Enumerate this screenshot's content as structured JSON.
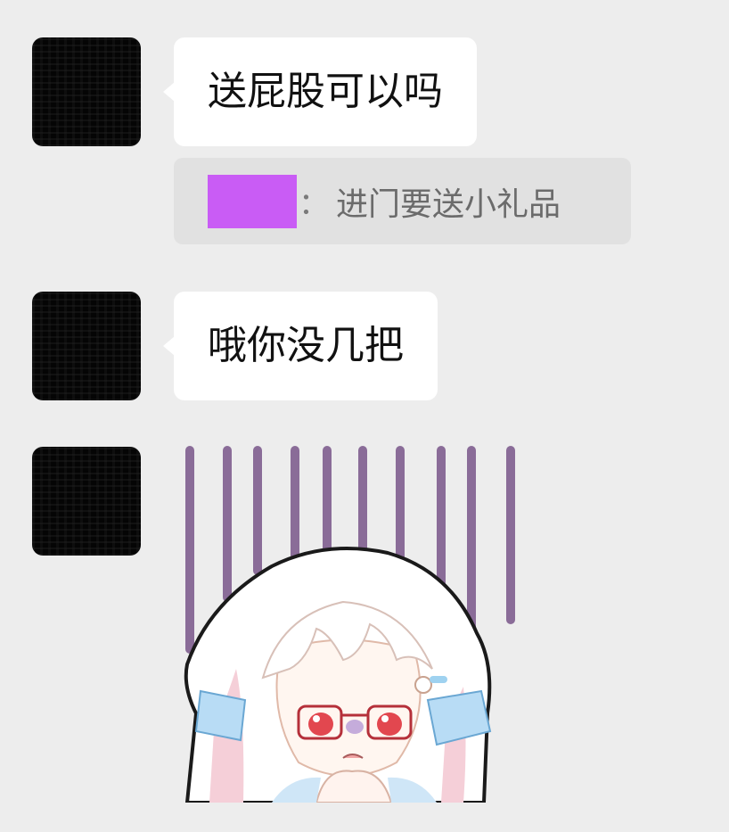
{
  "chat": {
    "messages": [
      {
        "type": "text",
        "text": "送屁股可以吗"
      },
      {
        "type": "quote",
        "text": "进门要送小礼品",
        "colon": "："
      },
      {
        "type": "text",
        "text": "哦你没几把"
      },
      {
        "type": "sticker"
      }
    ]
  },
  "colors": {
    "background": "#ededed",
    "bubble": "#ffffff",
    "quote_bg": "#e1e1e1",
    "redaction": "#c95cf5"
  },
  "icons": {
    "avatar": "avatar-icon",
    "sticker": "sad-chibi-girl-sticker"
  }
}
